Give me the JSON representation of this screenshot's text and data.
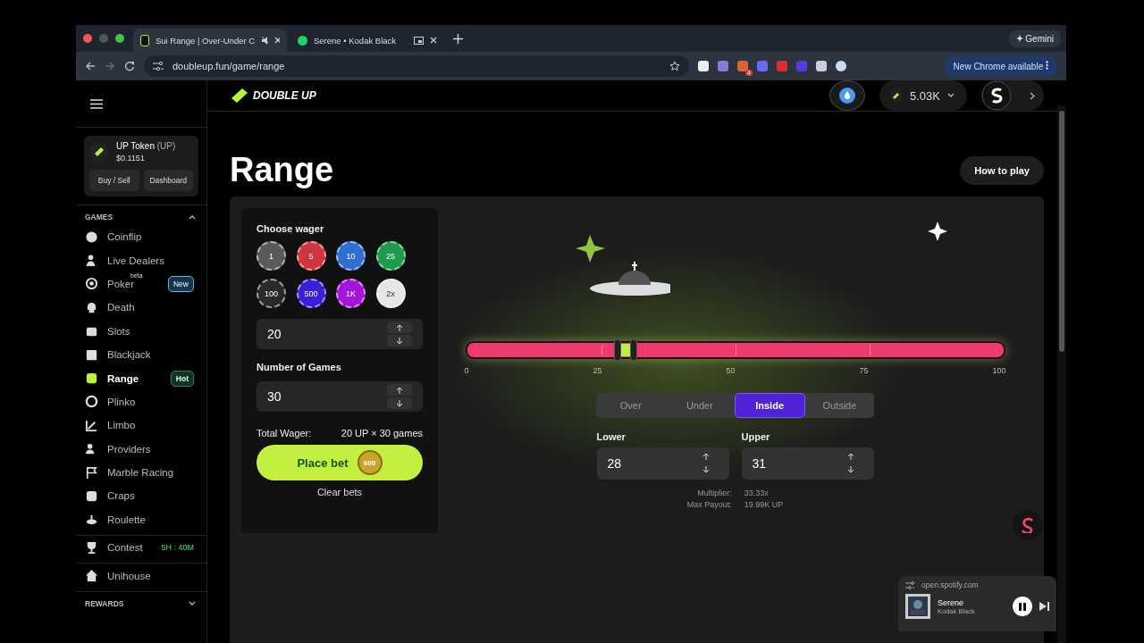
{
  "browser": {
    "tabs": [
      {
        "title": "Sui Range | Over-Under C",
        "selected": true,
        "muted": true
      },
      {
        "title": "Serene • Kodak Black",
        "selected": false,
        "muted": false
      }
    ],
    "url": "doubleup.fun/game/range",
    "extension_badge": "4",
    "gemini": "Gemini",
    "update": "New Chrome available"
  },
  "header": {
    "logo": "DOUBLE UP",
    "balance": "5.03K"
  },
  "sidebar": {
    "token": {
      "name": "UP Token",
      "symbol": "(UP)",
      "price": "$0.1151",
      "buttons": [
        "Buy / Sell",
        "Dashboard"
      ]
    },
    "games_heading": "GAMES",
    "games_expanded": true,
    "games": [
      {
        "label": "Coinflip",
        "selected": false
      },
      {
        "label": "Live Dealers",
        "selected": false
      },
      {
        "label": "Poker",
        "tag": "beta",
        "selected": false,
        "badge": {
          "text": "New",
          "kind": "new"
        }
      },
      {
        "label": "Death",
        "selected": false
      },
      {
        "label": "Slots",
        "selected": false
      },
      {
        "label": "Blackjack",
        "selected": false
      },
      {
        "label": "Range",
        "selected": true,
        "badge": {
          "text": "Hot",
          "kind": "hot"
        }
      },
      {
        "label": "Plinko",
        "selected": false
      },
      {
        "label": "Limbo",
        "selected": false
      },
      {
        "label": "Providers",
        "selected": false
      },
      {
        "label": "Marble Racing",
        "selected": false
      },
      {
        "label": "Craps",
        "selected": false
      },
      {
        "label": "Roulette",
        "selected": false
      }
    ],
    "contest": {
      "label": "Contest",
      "timer": "5H : 40M"
    },
    "unihouse": "Unihouse",
    "rewards_heading": "REWARDS",
    "rewards_expanded": false
  },
  "main": {
    "title": "Range",
    "how_to_play": "How to play"
  },
  "wager": {
    "label": "Choose wager",
    "chips": [
      {
        "label": "1",
        "color": "#5a5a5a"
      },
      {
        "label": "5",
        "color": "#d0343f"
      },
      {
        "label": "10",
        "color": "#2f6fd0"
      },
      {
        "label": "25",
        "color": "#1f9a4a"
      },
      {
        "label": "100",
        "color": "#2a2a2a"
      },
      {
        "label": "500",
        "color": "#3a1fd8"
      },
      {
        "label": "1K",
        "color": "#a515d8"
      },
      {
        "label": "2x",
        "color": "#e6e6e6"
      }
    ],
    "amount": "20",
    "games_label": "Number of Games",
    "games": "30",
    "total_label": "Total Wager:",
    "total": "20 UP × 30 games",
    "place_bet": "Place bet",
    "coin": "600",
    "clear": "Clear bets"
  },
  "game": {
    "ticks": [
      "0",
      "25",
      "50",
      "75",
      "100"
    ],
    "handles": [
      {
        "level": 0.28
      },
      {
        "level": 0.31
      }
    ],
    "modes": [
      {
        "label": "Over",
        "selected": false
      },
      {
        "label": "Under",
        "selected": false
      },
      {
        "label": "Inside",
        "selected": true
      },
      {
        "label": "Outside",
        "selected": false
      }
    ],
    "lower_label": "Lower",
    "lower": "28",
    "upper_label": "Upper",
    "upper": "31",
    "multiplier_label": "Multiplier:",
    "multiplier": "33.33x",
    "payout_label": "Max Payout:",
    "payout": "19.99K UP"
  },
  "media": {
    "site": "open.spotify.com",
    "title": "Serene",
    "artist": "Kodak Black"
  }
}
